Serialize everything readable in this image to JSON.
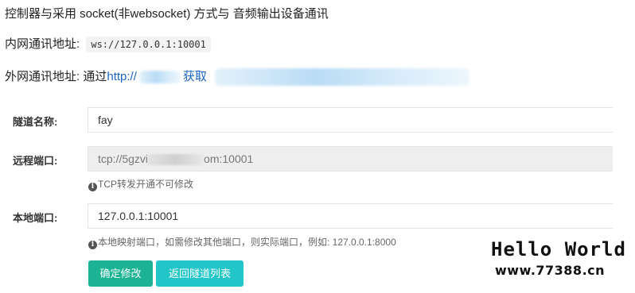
{
  "intro": {
    "text": "控制器与采用 socket(非websocket) 方式与 音频输出设备通讯",
    "internal_label": "内网通讯地址:",
    "internal_address": "ws://127.0.0.1:10001",
    "external_label": "外网通讯地址:",
    "external_prefix": "通过",
    "external_link": "http://",
    "external_get": "获取"
  },
  "form": {
    "tunnel_name_label": "隧道名称:",
    "tunnel_name_value": "fay",
    "remote_port_label": "远程端口:",
    "remote_port_value_start": "tcp://5gzvi",
    "remote_port_value_end": "om:10001",
    "remote_port_help": "TCP转发开通不可修改",
    "local_port_label": "本地端口:",
    "local_port_value": "127.0.0.1:10001",
    "local_port_help": "本地映射端口，如需修改其他端口，则实际端口，例如:  127.0.0.1:8000"
  },
  "buttons": {
    "confirm": "确定修改",
    "back": "返回隧道列表"
  },
  "watermark": {
    "title": "Hello World",
    "site": "www.77388.cn"
  },
  "colors": {
    "confirm_button": "#1bb394",
    "back_button": "#23c6c8",
    "link": "#1a66c2"
  }
}
